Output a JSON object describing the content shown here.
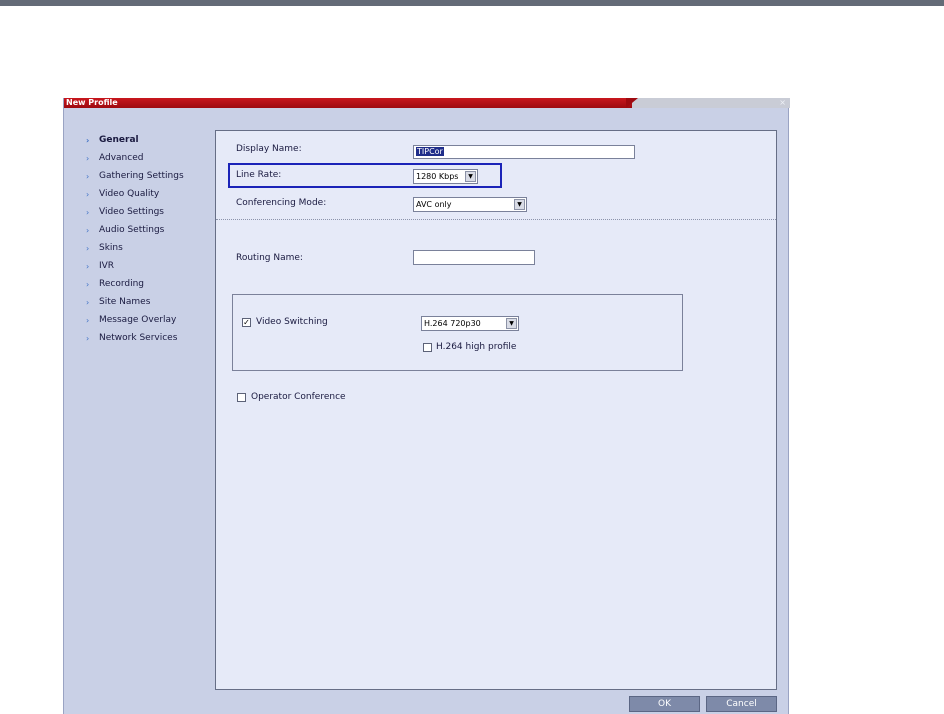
{
  "dialog": {
    "title": "New Profile",
    "close_glyph": "×"
  },
  "nav": {
    "items": [
      {
        "label": "General",
        "active": true
      },
      {
        "label": "Advanced"
      },
      {
        "label": "Gathering Settings"
      },
      {
        "label": "Video Quality"
      },
      {
        "label": "Video Settings"
      },
      {
        "label": "Audio Settings"
      },
      {
        "label": "Skins"
      },
      {
        "label": "IVR"
      },
      {
        "label": "Recording"
      },
      {
        "label": "Site Names"
      },
      {
        "label": "Message Overlay"
      },
      {
        "label": "Network Services"
      }
    ],
    "chevron_icon": "chevron-right-icon"
  },
  "form": {
    "display_name": {
      "label": "Display Name:",
      "value": "TIPCor"
    },
    "line_rate": {
      "label": "Line Rate:",
      "value": "1280 Kbps"
    },
    "conferencing_mode": {
      "label": "Conferencing Mode:",
      "value": "AVC only"
    },
    "routing_name": {
      "label": "Routing Name:",
      "value": ""
    },
    "video_switching": {
      "label": "Video Switching",
      "checked": true,
      "value": "H.264 720p30"
    },
    "h264_high_profile": {
      "label": "H.264 high profile",
      "checked": false
    },
    "operator_conference": {
      "label": "Operator Conference",
      "checked": false
    }
  },
  "buttons": {
    "ok": "OK",
    "cancel": "Cancel"
  },
  "colors": {
    "titlebar_red": "#c8171e",
    "highlight_box": "#1b23b8",
    "content_bg": "#e6eaf8",
    "dialog_bg": "#c9d0e6"
  }
}
